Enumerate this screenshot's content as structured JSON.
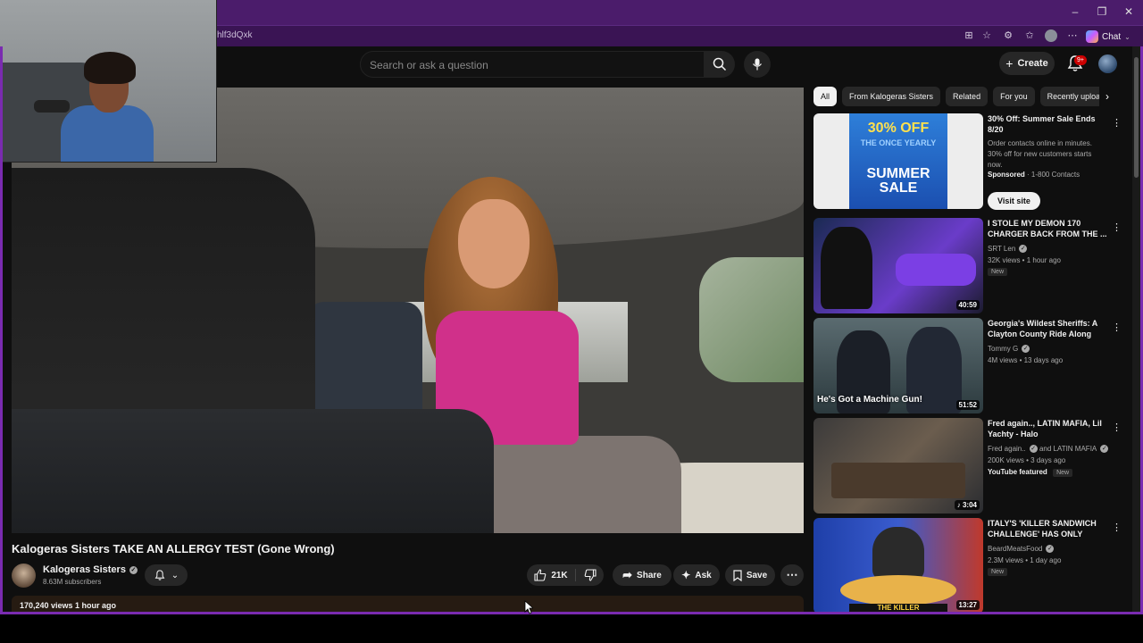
{
  "browser": {
    "url": "hlf3dQxk",
    "chat_label": "Chat",
    "window_controls": [
      "minimize",
      "restore",
      "close"
    ]
  },
  "header": {
    "search_placeholder": "Search or ask a question",
    "create_label": "Create",
    "notification_badge": "9+"
  },
  "video": {
    "title": "Kalogeras Sisters TAKE AN ALLERGY TEST (Gone Wrong)",
    "channel": "Kalogeras Sisters",
    "subscribers": "8.63M subscribers",
    "likes": "21K",
    "share_label": "Share",
    "ask_label": "Ask",
    "save_label": "Save",
    "views_meta": "170,240 views  1 hour ago"
  },
  "chips": [
    "All",
    "From Kalogeras Sisters",
    "Related",
    "For you",
    "Recently uploaded"
  ],
  "sidebar": [
    {
      "type": "ad",
      "title": "30% Off: Summer Sale Ends 8/20",
      "desc": "Order contacts online in minutes. 30% off for new customers starts now.",
      "sponsored": "Sponsored",
      "advertiser": "· 1-800 Contacts",
      "cta": "Visit site",
      "thumb_text_1": "30% OFF",
      "thumb_text_2": "THE ONCE YEARLY",
      "thumb_text_3": "SUMMER SALE"
    },
    {
      "title": "I STOLE MY DEMON 170 CHARGER BACK FROM THE ...",
      "channel": "SRT Len",
      "meta": "32K views • 1 hour ago",
      "badge": "New",
      "duration": "40:59"
    },
    {
      "title": "Georgia's Wildest Sheriffs: A Clayton County Ride Along",
      "channel": "Tommy G",
      "meta": "4M views • 13 days ago",
      "duration": "51:52",
      "overlay": "He's Got a Machine Gun!"
    },
    {
      "title": "Fred again.., LATIN MAFIA, Lil Yachty - Halo",
      "channel": "Fred again..",
      "channel_extra": "and LATIN MAFIA",
      "meta": "200K views • 3 days ago",
      "featured": "YouTube featured",
      "badge": "New",
      "duration": "3:04"
    },
    {
      "title": "ITALY'S 'KILLER SANDWICH CHALLENGE' HAS ONLY BEEN...",
      "channel": "BeardMeatsFood",
      "meta": "2.3M views • 1 day ago",
      "badge": "New",
      "duration": "13:27",
      "thumb_banner": "THE KILLER"
    }
  ]
}
